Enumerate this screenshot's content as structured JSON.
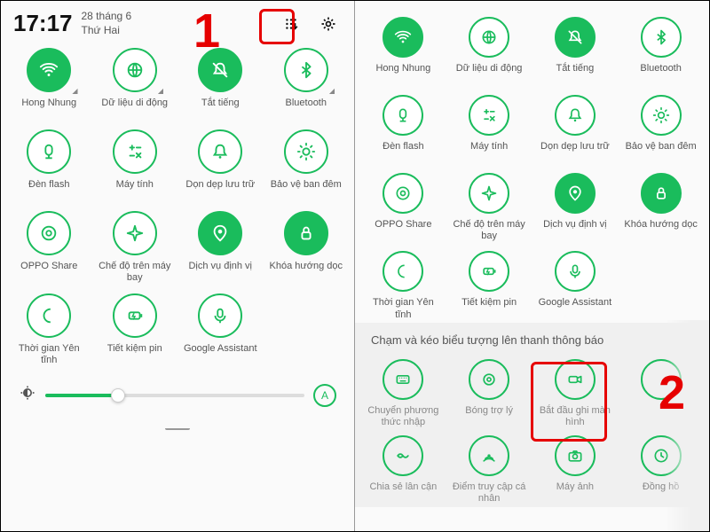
{
  "status": {
    "time": "17:17",
    "date_line1": "28 tháng 6",
    "date_line2": "Thứ Hai"
  },
  "steps": {
    "one": "1",
    "two": "2"
  },
  "slider": {
    "auto_label": "A"
  },
  "left_tiles": [
    {
      "name": "wifi",
      "label": "Hong Nhung",
      "icon": "wifi",
      "on": true,
      "corner": true
    },
    {
      "name": "mobile-data",
      "label": "Dữ liệu di động",
      "icon": "globe",
      "on": false,
      "corner": true
    },
    {
      "name": "mute",
      "label": "Tắt tiếng",
      "icon": "bell-off",
      "on": true,
      "corner": false
    },
    {
      "name": "bluetooth",
      "label": "Bluetooth",
      "icon": "bt",
      "on": false,
      "corner": true
    },
    {
      "name": "flashlight",
      "label": "Đèn flash",
      "icon": "flash",
      "on": false
    },
    {
      "name": "calculator",
      "label": "Máy tính",
      "icon": "calc",
      "on": false
    },
    {
      "name": "cleanup",
      "label": "Dọn dẹp lưu trữ",
      "icon": "bell",
      "on": false
    },
    {
      "name": "eye-comfort",
      "label": "Bảo vệ ban đêm",
      "icon": "sun",
      "on": false
    },
    {
      "name": "oppo-share",
      "label": "OPPO Share",
      "icon": "share",
      "on": false
    },
    {
      "name": "airplane",
      "label": "Chế độ trên máy bay",
      "icon": "plane",
      "on": false
    },
    {
      "name": "location",
      "label": "Dịch vụ định vị",
      "icon": "pin",
      "on": true
    },
    {
      "name": "rotation-lock",
      "label": "Khóa hướng dọc",
      "icon": "lock",
      "on": true
    },
    {
      "name": "quiet-time",
      "label": "Thời gian Yên tĩnh",
      "icon": "moon",
      "on": false
    },
    {
      "name": "battery-saver",
      "label": "Tiết kiệm pin",
      "icon": "battery",
      "on": false
    },
    {
      "name": "google-assistant",
      "label": "Google Assistant",
      "icon": "mic",
      "on": false
    }
  ],
  "right_tiles": [
    {
      "name": "wifi",
      "label": "Hong Nhung",
      "icon": "wifi",
      "on": true
    },
    {
      "name": "mobile-data",
      "label": "Dữ liệu di động",
      "icon": "globe",
      "on": false
    },
    {
      "name": "mute",
      "label": "Tắt tiếng",
      "icon": "bell-off",
      "on": true
    },
    {
      "name": "bluetooth",
      "label": "Bluetooth",
      "icon": "bt",
      "on": false
    },
    {
      "name": "flashlight",
      "label": "Đèn flash",
      "icon": "flash",
      "on": false
    },
    {
      "name": "calculator",
      "label": "Máy tính",
      "icon": "calc",
      "on": false
    },
    {
      "name": "cleanup",
      "label": "Dọn dẹp lưu trữ",
      "icon": "bell",
      "on": false
    },
    {
      "name": "eye-comfort",
      "label": "Bảo vệ ban đêm",
      "icon": "sun",
      "on": false
    },
    {
      "name": "oppo-share",
      "label": "OPPO Share",
      "icon": "share",
      "on": false
    },
    {
      "name": "airplane",
      "label": "Chế độ trên máy bay",
      "icon": "plane",
      "on": false
    },
    {
      "name": "location",
      "label": "Dịch vụ định vị",
      "icon": "pin",
      "on": true
    },
    {
      "name": "rotation-lock",
      "label": "Khóa hướng dọc",
      "icon": "lock",
      "on": true
    },
    {
      "name": "quiet-time",
      "label": "Thời gian Yên tĩnh",
      "icon": "moon",
      "on": false
    },
    {
      "name": "battery-saver",
      "label": "Tiết kiệm pin",
      "icon": "battery",
      "on": false
    },
    {
      "name": "google-assistant",
      "label": "Google Assistant",
      "icon": "mic",
      "on": false
    }
  ],
  "tray_header": "Chạm và kéo biểu tượng lên thanh thông báo",
  "tray_tiles": [
    {
      "name": "input-method",
      "label": "Chuyển phương thức nhập",
      "icon": "kbd"
    },
    {
      "name": "assistive-ball",
      "label": "Bóng trợ lý",
      "icon": "ring"
    },
    {
      "name": "screen-record",
      "label": "Bắt đầu ghi màn hình",
      "icon": "camcorder"
    },
    {
      "name": "overflow",
      "label": "",
      "icon": "blank"
    },
    {
      "name": "nearby-share",
      "label": "Chia sẻ lân cận",
      "icon": "nearby"
    },
    {
      "name": "hotspot",
      "label": "Điểm truy cập cá nhân",
      "icon": "hotspot"
    },
    {
      "name": "camera",
      "label": "Máy ảnh",
      "icon": "camera"
    },
    {
      "name": "clock",
      "label": "Đồng hồ",
      "icon": "clock"
    }
  ]
}
